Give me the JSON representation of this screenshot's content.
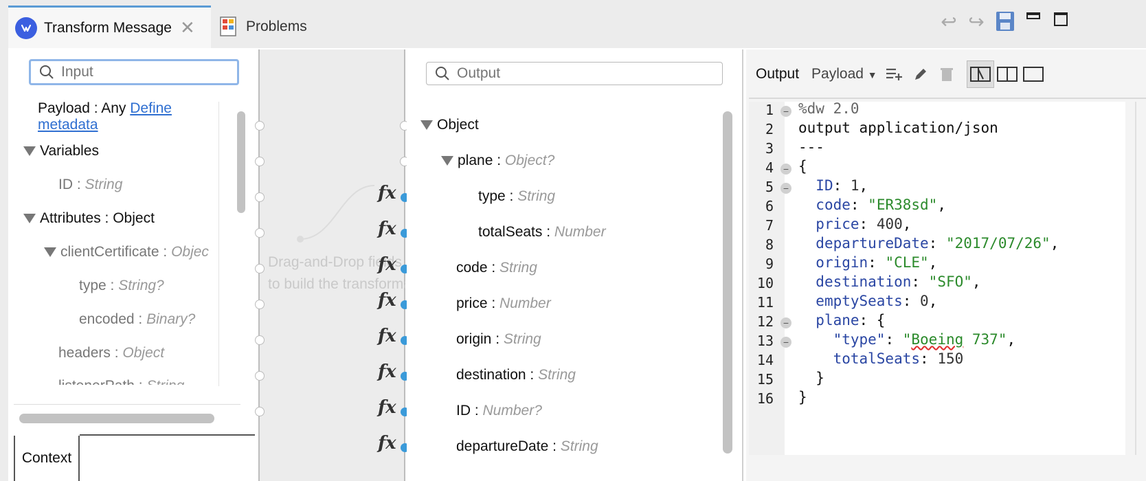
{
  "tabs": {
    "transform_label": "Transform Message",
    "problems_label": "Problems"
  },
  "input": {
    "search_placeholder": "Input",
    "payload_label": "Payload : Any",
    "define_link_1": "Define",
    "define_link_2": "metadata",
    "variables_label": "Variables",
    "id_name": "ID : ",
    "id_type": "String",
    "attributes_label": "Attributes : Object",
    "client_cert_name": "clientCertificate : ",
    "client_cert_type": "Objec",
    "type_name": "type : ",
    "type_type": "String?",
    "encoded_name": "encoded : ",
    "encoded_type": "Binary?",
    "headers_name": "headers : ",
    "headers_type": "Object",
    "listener_name": "listenerPath : ",
    "listener_type": "String",
    "context_tab": "Context"
  },
  "mapping": {
    "drag_line1": "Drag-and-Drop fields",
    "drag_line2": "to build the transformation",
    "fx_label": "fx"
  },
  "output": {
    "search_placeholder": "Output",
    "object_label": "Object",
    "plane_name": "plane : ",
    "plane_type": "Object?",
    "fields": [
      {
        "name": "type : ",
        "type": "String"
      },
      {
        "name": "totalSeats : ",
        "type": "Number"
      },
      {
        "name": "code : ",
        "type": "String"
      },
      {
        "name": "price : ",
        "type": "Number"
      },
      {
        "name": "origin : ",
        "type": "String"
      },
      {
        "name": "destination : ",
        "type": "String"
      },
      {
        "name": "ID : ",
        "type": "Number?"
      },
      {
        "name": "departureDate : ",
        "type": "String"
      }
    ]
  },
  "preview": {
    "output_label": "Output",
    "payload_label": "Payload",
    "code": {
      "l1": "%dw 2.0",
      "l2": "output application/json",
      "l3": "---",
      "l4": "{",
      "l5k": "ID",
      "l5v": "1",
      "l6k": "code",
      "l6v": "\"ER38sd\"",
      "l7k": "price",
      "l7v": "400",
      "l8k": "departureDate",
      "l8v": "\"2017/07/26\"",
      "l9k": "origin",
      "l9v": "\"CLE\"",
      "l10k": "destination",
      "l10v": "\"SFO\"",
      "l11k": "emptySeats",
      "l11v": "0",
      "l12k": "plane",
      "l13k": "\"type\"",
      "l13v1": "\"",
      "l13v2": "Boeing",
      "l13v3": " 737\"",
      "l14k": "totalSeats",
      "l14v": "150",
      "l15": "}",
      "l16": "}"
    },
    "line_numbers": [
      "1",
      "2",
      "3",
      "4",
      "5",
      "6",
      "7",
      "8",
      "9",
      "10",
      "11",
      "12",
      "13",
      "14",
      "15",
      "16"
    ]
  }
}
